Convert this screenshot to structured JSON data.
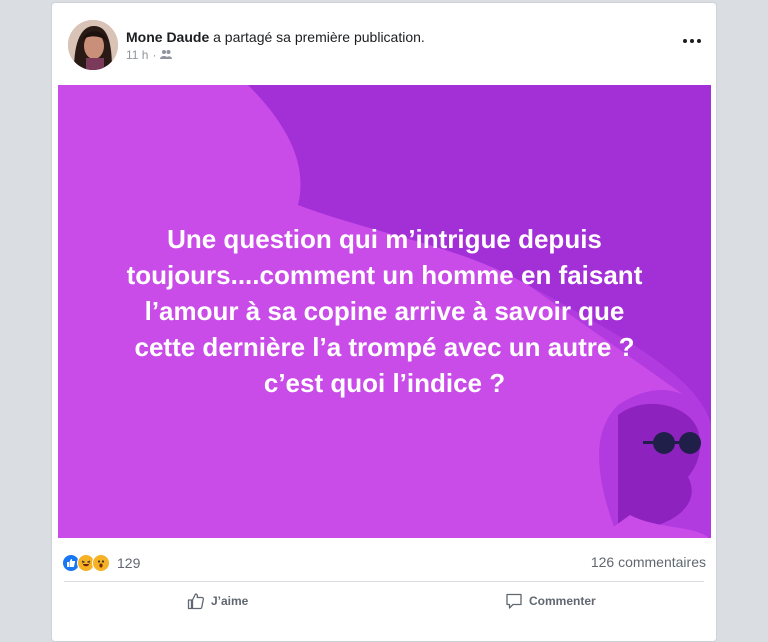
{
  "post": {
    "author": "Mone Daude",
    "action": "a partagé sa première publication.",
    "time": "11 h",
    "separator": "·",
    "privacy_icon": "friends-icon",
    "text": "Une question qui m’intrigue depuis\ntoujours....comment un homme en faisant\nl’amour à sa copine arrive à savoir que\ncette dernière l’a trompé avec un autre ?\nc’est quoi l’indice ?"
  },
  "colors": {
    "post_bg": "#a32fd6",
    "post_bg_light": "#c94ce8",
    "post_bg_dark": "#9a28c8",
    "accent": "#1877f2"
  },
  "reactions": {
    "icons": [
      "like-reaction-icon",
      "haha-reaction-icon",
      "wow-reaction-icon"
    ],
    "count": "129",
    "comments": "126 commentaires"
  },
  "actions": {
    "like_label": "J’aime",
    "comment_label": "Commenter"
  }
}
